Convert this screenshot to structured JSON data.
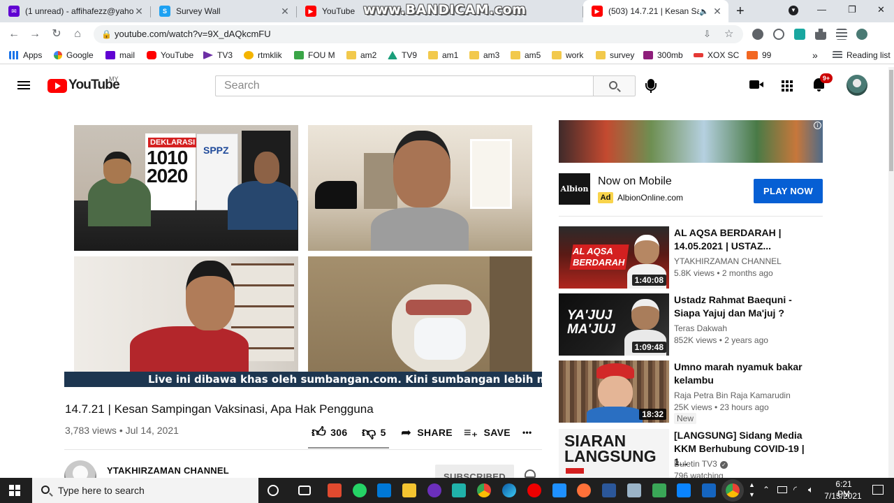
{
  "browser": {
    "tabs": [
      {
        "title": "(1 unread) - affihafezz@yahoo",
        "favicon": "mail-icon",
        "color": "#6001d2"
      },
      {
        "title": "Survey Wall",
        "favicon": "survey-icon",
        "color": "#1da1f2"
      },
      {
        "title": "YouTube",
        "favicon": "youtube-icon",
        "color": "#ff0000"
      },
      {
        "title": "(503) 14.7.21 | Kesan Sam",
        "favicon": "youtube-icon",
        "color": "#ff0000"
      }
    ],
    "new_tab_label": "+",
    "watermark": "www.BANDICAM.com",
    "url": "youtube.com/watch?v=9X_dAQkcmFU",
    "bookmarks": [
      {
        "label": "Apps",
        "icon": "apps-grid-icon"
      },
      {
        "label": "Google",
        "icon": "google-icon"
      },
      {
        "label": "mail",
        "icon": "mail-icon"
      },
      {
        "label": "YouTube",
        "icon": "youtube-icon"
      },
      {
        "label": "TV3",
        "icon": "tv3-icon"
      },
      {
        "label": "rtmklik",
        "icon": "rtmklik-icon"
      },
      {
        "label": "FOU M",
        "icon": "fm-icon"
      },
      {
        "label": "am2",
        "icon": "folder-icon"
      },
      {
        "label": "TV9",
        "icon": "tv9-icon"
      },
      {
        "label": "am1",
        "icon": "folder-icon"
      },
      {
        "label": "am3",
        "icon": "folder-icon"
      },
      {
        "label": "am5",
        "icon": "folder-icon"
      },
      {
        "label": "work",
        "icon": "folder-icon"
      },
      {
        "label": "survey",
        "icon": "folder-icon"
      },
      {
        "label": "300mb",
        "icon": "300mb-icon"
      },
      {
        "label": "XOX SC",
        "icon": "xox-icon"
      },
      {
        "label": "99",
        "icon": "99-icon"
      }
    ],
    "bookmarks_overflow": "»",
    "reading_list": "Reading list"
  },
  "youtube": {
    "logo_text": "YouTube",
    "country_code": "MY",
    "search_placeholder": "Search",
    "notification_count": "9+"
  },
  "player": {
    "ticker": "Live ini dibawa khas oleh sumbangan.com. Kini sumbangan lebih mudah berjaya",
    "banner_label": "DEKLARASI",
    "banner_number": "1010 2020",
    "banner_org": "SPPZ"
  },
  "video": {
    "title": "14.7.21 | Kesan Sampingan Vaksinasi, Apa Hak Pengguna",
    "views": "3,783 views",
    "date": "Jul 14, 2021",
    "likes": "306",
    "dislikes": "5",
    "share_label": "SHARE",
    "save_label": "SAVE",
    "more_label": "•••",
    "channel": "YTAKHIRZAMAN CHANNEL",
    "subscribe_label": "SUBSCRIBED"
  },
  "ad": {
    "title": "Now on Mobile",
    "badge": "Ad",
    "domain": "AlbionOnline.com",
    "logo_text": "Albion",
    "cta": "PLAY NOW",
    "info_glyph": "i"
  },
  "recommendations": [
    {
      "title": "AL AQSA BERDARAH | 14.05.2021 | USTAZ...",
      "channel": "YTAKHIRZAMAN CHANNEL",
      "views": "5.8K views",
      "age": "2 months ago",
      "duration": "1:40:08",
      "thumb_text": "AL AQSA BERDARAH",
      "verified": false,
      "new": ""
    },
    {
      "title": "Ustadz Rahmat Baequni - Siapa Yajuj dan Ma'juj ?",
      "channel": "Teras Dakwah",
      "views": "852K views",
      "age": "2 years ago",
      "duration": "1:09:48",
      "thumb_text": "YA'JUJ MA'JUJ",
      "verified": false,
      "new": ""
    },
    {
      "title": "Umno marah nyamuk bakar kelambu",
      "channel": "Raja Petra Bin Raja Kamarudin",
      "views": "25K views",
      "age": "23 hours ago",
      "duration": "18:32",
      "thumb_text": "",
      "verified": false,
      "new": "New"
    },
    {
      "title": "[LANGSUNG] Sidang Media KKM Berhubung COVID-19 | 1...",
      "channel": "Buletin TV3",
      "views": "796 watching",
      "age": "",
      "duration": "",
      "thumb_text": "SIARAN LANGSUNG",
      "verified": true,
      "new": ""
    }
  ],
  "taskbar": {
    "search_placeholder": "Type here to search",
    "time": "6:21 PM",
    "date": "7/15/2021"
  }
}
